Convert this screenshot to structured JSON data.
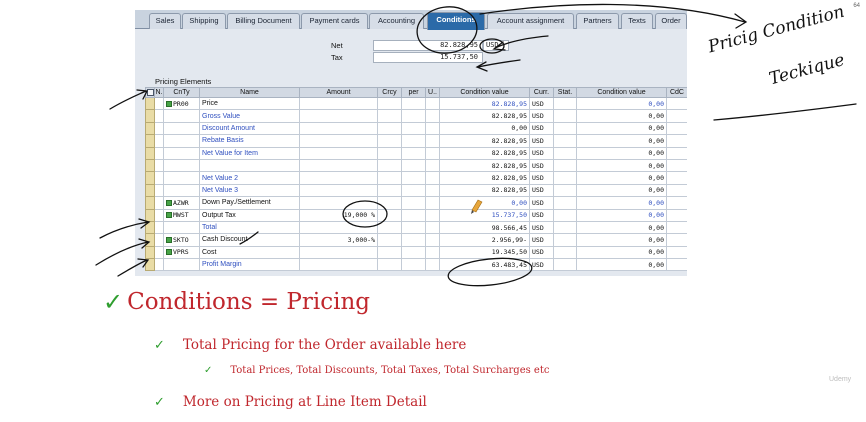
{
  "slide_number": "64",
  "watermark": "Udemy",
  "tabs": [
    {
      "label": "Sales"
    },
    {
      "label": "Shipping"
    },
    {
      "label": "Billing Document"
    },
    {
      "label": "Payment cards"
    },
    {
      "label": "Accounting"
    },
    {
      "label": "Conditions"
    },
    {
      "label": "Account assignment"
    },
    {
      "label": "Partners"
    },
    {
      "label": "Texts"
    },
    {
      "label": "Order"
    }
  ],
  "active_tab": "Conditions",
  "header": {
    "net_label": "Net",
    "net_value": "82.828,95",
    "net_currency": "USD",
    "tax_label": "Tax",
    "tax_value": "15.737,50"
  },
  "section_title": "Pricing Elements",
  "columns": [
    "N.",
    "CnTy",
    "Name",
    "Amount",
    "Crcy",
    "per",
    "U..",
    "Condition value",
    "Curr.",
    "Stat.",
    "Condition value",
    "CdC"
  ],
  "rows": [
    {
      "indicator": true,
      "cnty": "PR00",
      "name": "Price",
      "name_blue": false,
      "amount": "",
      "cond_value": "82.828,95",
      "value_blue": true,
      "curr": "USD",
      "cond_value2": "0,00",
      "v2_blue": true
    },
    {
      "indicator": false,
      "cnty": "",
      "name": "Gross Value",
      "name_blue": true,
      "amount": "",
      "cond_value": "82.828,95",
      "value_blue": false,
      "curr": "USD",
      "cond_value2": "0,00",
      "v2_blue": false
    },
    {
      "indicator": false,
      "cnty": "",
      "name": "Discount Amount",
      "name_blue": true,
      "amount": "",
      "cond_value": "0,00",
      "value_blue": false,
      "curr": "USD",
      "cond_value2": "0,00",
      "v2_blue": false
    },
    {
      "indicator": false,
      "cnty": "",
      "name": "Rebate Basis",
      "name_blue": true,
      "amount": "",
      "cond_value": "82.828,95",
      "value_blue": false,
      "curr": "USD",
      "cond_value2": "0,00",
      "v2_blue": false
    },
    {
      "indicator": false,
      "cnty": "",
      "name": "Net Value for Item",
      "name_blue": true,
      "amount": "",
      "cond_value": "82.828,95",
      "value_blue": false,
      "curr": "USD",
      "cond_value2": "0,00",
      "v2_blue": false
    },
    {
      "indicator": false,
      "cnty": "",
      "name": "",
      "name_blue": false,
      "amount": "",
      "cond_value": "82.828,95",
      "value_blue": false,
      "curr": "USD",
      "cond_value2": "0,00",
      "v2_blue": false
    },
    {
      "indicator": false,
      "cnty": "",
      "name": "Net Value 2",
      "name_blue": true,
      "amount": "",
      "cond_value": "82.828,95",
      "value_blue": false,
      "curr": "USD",
      "cond_value2": "0,00",
      "v2_blue": false
    },
    {
      "indicator": false,
      "cnty": "",
      "name": "Net Value 3",
      "name_blue": true,
      "amount": "",
      "cond_value": "82.828,95",
      "value_blue": false,
      "curr": "USD",
      "cond_value2": "0,00",
      "v2_blue": false
    },
    {
      "indicator": true,
      "cnty": "AZWR",
      "name": "Down Pay./Settlement",
      "name_blue": false,
      "amount": "",
      "cond_value": "0,00",
      "value_blue": true,
      "curr": "USD",
      "cond_value2": "0,00",
      "v2_blue": true
    },
    {
      "indicator": true,
      "cnty": "MWST",
      "name": "Output Tax",
      "name_blue": false,
      "amount": "19,000 %",
      "cond_value": "15.737,50",
      "value_blue": true,
      "curr": "USD",
      "cond_value2": "0,00",
      "v2_blue": true
    },
    {
      "indicator": false,
      "cnty": "",
      "name": "Total",
      "name_blue": true,
      "amount": "",
      "cond_value": "98.566,45",
      "value_blue": false,
      "curr": "USD",
      "cond_value2": "0,00",
      "v2_blue": false
    },
    {
      "indicator": true,
      "cnty": "SKTO",
      "name": "Cash Discount",
      "name_blue": false,
      "amount": "3,000-%",
      "cond_value": "2.956,99-",
      "value_blue": false,
      "curr": "USD",
      "cond_value2": "0,00",
      "v2_blue": false
    },
    {
      "indicator": true,
      "cnty": "VPRS",
      "name": "Cost",
      "name_blue": false,
      "amount": "",
      "cond_value": "19.345,50",
      "value_blue": false,
      "curr": "USD",
      "cond_value2": "0,00",
      "v2_blue": false
    },
    {
      "indicator": false,
      "cnty": "",
      "name": "Profit Margin",
      "name_blue": true,
      "amount": "",
      "cond_value": "63.483,45",
      "value_blue": false,
      "curr": "USD",
      "cond_value2": "0,00",
      "v2_blue": false
    }
  ],
  "handwriting": {
    "line1": "Pricig Condition",
    "line2": "Teckique"
  },
  "bullets": {
    "main": "Conditions = Pricing",
    "sub1": "Total Pricing for the Order available here",
    "sub1_detail": "Total Prices, Total Discounts, Total Taxes, Total Surcharges etc",
    "sub2": "More on Pricing at Line Item Detail"
  },
  "colors": {
    "heading_red": "#c0272d",
    "check_green": "#2f9e2f",
    "sap_active_tab": "#2b6aa8",
    "sap_blue_text": "#2f4fbf"
  }
}
